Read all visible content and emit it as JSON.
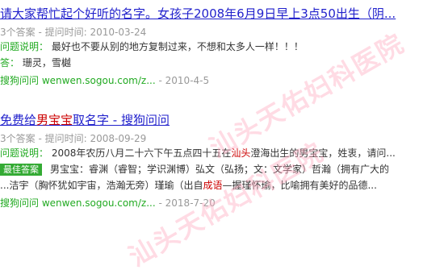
{
  "results": [
    {
      "title": "请大家帮忙起个好听的名字。女孩子2008年6月9日早上3点50出生（阴...",
      "meta": {
        "answers": "3个答案",
        "separator": "-",
        "time_label": "提问时间:",
        "time": "2010-03-24"
      },
      "question_label": "问题说明：",
      "question_text": "最好也不要从别的地方复制过来，不想和太多人一样！！！",
      "answer_label": "答：",
      "answer_text": "珊灵，雪樾",
      "source": {
        "site": "搜狗问问",
        "url": "wenwen.sogou.com/z...",
        "separator": "-",
        "date": "2010-4-5"
      }
    },
    {
      "title_before": "免费给",
      "title_highlight": "男宝宝",
      "title_after": "取名字 - 搜狗问问",
      "meta": {
        "answers": "3个答案",
        "separator": "-",
        "time_label": "提问时间:",
        "time": "2008-09-29"
      },
      "question_label": "问题说明：",
      "question_before": "2008年农历八月二十六下午五点四十五在",
      "question_highlight": "汕头",
      "question_after": "澄海出生的男宝宝，姓衷，请问...",
      "best_badge": "最佳答案",
      "best_before": "男宝宝：睿渊（睿智；学识渊博）弘文（弘扬；文：文学家）哲瀚（拥有广大的",
      "best_line2_before": "...洁宇（胸怀犹如宇宙，浩瀚无旁）瑾瑜（出自",
      "best_line2_highlight": "成语",
      "best_line2_after": "—握瑾怀瑜，比喻拥有美好的品德...",
      "source": {
        "site": "搜狗问问",
        "url": "wenwen.sogou.com/z...",
        "separator": "-",
        "date": "2018-7-20"
      }
    }
  ],
  "watermark": {
    "text": "汕头天佑妇科医院"
  }
}
